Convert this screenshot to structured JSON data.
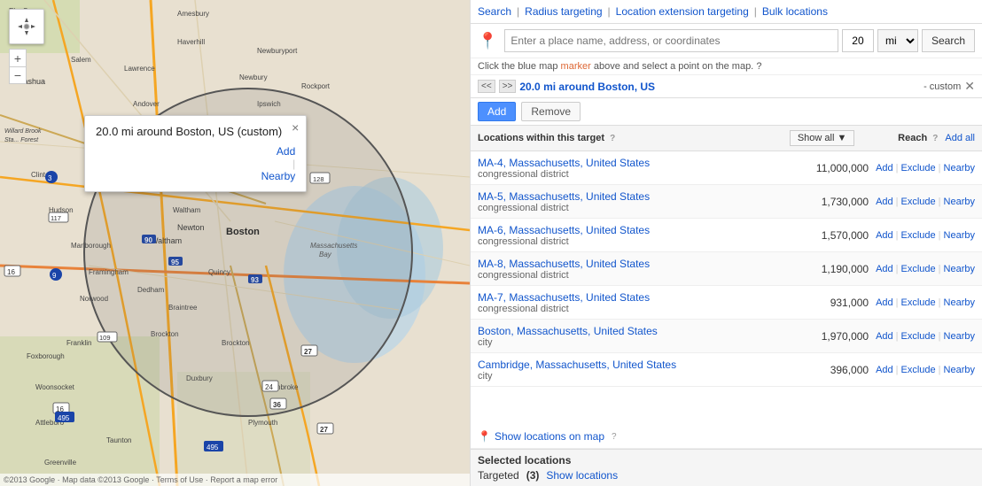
{
  "nav": {
    "search": "Search",
    "radius": "Radius targeting",
    "location_ext": "Location extension targeting",
    "bulk": "Bulk locations"
  },
  "search_bar": {
    "placeholder": "Enter a place name, address, or coordinates",
    "distance": "20",
    "unit": "mi",
    "button": "Search",
    "hint_text": "Click the blue map",
    "hint_link": "marker",
    "hint_end": "above and select a point on the map.",
    "help": "?"
  },
  "radius_bar": {
    "title": "20.0 mi around Boston, US",
    "custom": "- custom"
  },
  "actions": {
    "add": "Add",
    "remove": "Remove"
  },
  "table_header": {
    "locations": "Locations within this target",
    "help": "?",
    "show_all": "Show all",
    "reach": "Reach",
    "reach_help": "?",
    "add_all": "Add all"
  },
  "locations": [
    {
      "name": "MA-4, Massachusetts, United States",
      "type": "congressional district",
      "reach": "11,000,000"
    },
    {
      "name": "MA-5, Massachusetts, United States",
      "type": "congressional district",
      "reach": "1,730,000"
    },
    {
      "name": "MA-6, Massachusetts, United States",
      "type": "congressional district",
      "reach": "1,570,000"
    },
    {
      "name": "MA-8, Massachusetts, United States",
      "type": "congressional district",
      "reach": "1,190,000"
    },
    {
      "name": "MA-7, Massachusetts, United States",
      "type": "congressional district",
      "reach": "931,000"
    },
    {
      "name": "Boston, Massachusetts, United States",
      "type": "city",
      "reach": "1,970,000"
    },
    {
      "name": "Cambridge, Massachusetts, United States",
      "type": "city",
      "reach": "396,000"
    }
  ],
  "location_actions": {
    "add": "Add",
    "exclude": "Exclude",
    "nearby": "Nearby"
  },
  "show_on_map": {
    "label": "Show locations on map",
    "help": "?"
  },
  "selected": {
    "title": "Selected locations",
    "targeted_label": "Targeted",
    "targeted_count": "(3)",
    "show_locations": "Show locations"
  },
  "map_tooltip": {
    "title": "20.0 mi around Boston, US (custom)",
    "add": "Add",
    "nearby": "Nearby"
  },
  "map_copyright": "©2013 Google · Map data ©2013 Google · Terms of Use · Report a map error"
}
